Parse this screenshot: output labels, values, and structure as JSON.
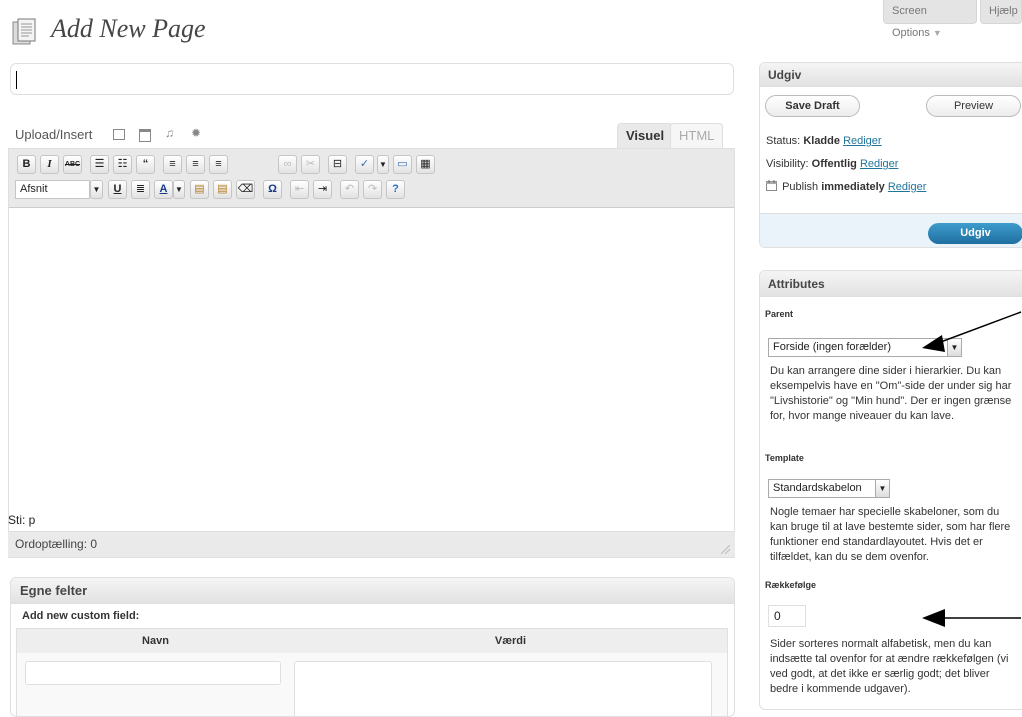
{
  "header": {
    "screen_options": "Screen Options",
    "help": "Hjælp",
    "title": "Add New Page"
  },
  "editor": {
    "upload_insert": "Upload/Insert",
    "tabs": [
      "Visuel",
      "HTML"
    ],
    "format_select": "Afsnit",
    "path": "Sti: p",
    "word_count": "Ordoptælling: 0"
  },
  "custom_fields": {
    "title": "Egne felter",
    "subtitle": "Add new custom field:",
    "col_name": "Navn",
    "col_value": "Værdi"
  },
  "publish": {
    "title": "Udgiv",
    "save_draft": "Save Draft",
    "preview": "Preview",
    "status_label": "Status:",
    "status_value": "Kladde",
    "visibility_label": "Visibility:",
    "visibility_value": "Offentlig",
    "publish_label": "Publish",
    "publish_value": "immediately",
    "edit_link": "Rediger",
    "publish_button": "Udgiv"
  },
  "attributes": {
    "title": "Attributes",
    "parent_label": "Parent",
    "parent_value": "Forside (ingen forælder)",
    "parent_help": "Du kan arrangere dine sider i hierarkier. Du kan eksempelvis have en \"Om\"-side der under sig har \"Livshistorie\" og \"Min hund\". Der er ingen grænse for, hvor mange niveauer du kan lave.",
    "template_label": "Template",
    "template_value": "Standardskabelon",
    "template_help": "Nogle temaer har specielle skabeloner, som du kan bruge til at lave bestemte sider, som har flere funktioner end standardlayoutet. Hvis det er tilfældet, kan du se dem ovenfor.",
    "order_label": "Rækkefølge",
    "order_value": "0",
    "order_help": "Sider sorteres normalt alfabetisk, men du kan indsætte tal ovenfor for at ændre rækkefølgen (vi ved godt, at det ikke er særlig godt; det bliver bedre i kommende udgaver)."
  },
  "colors": {
    "link": "#21759b",
    "publish_button": "#2a85b8",
    "box_header": "#e4e4e4"
  }
}
